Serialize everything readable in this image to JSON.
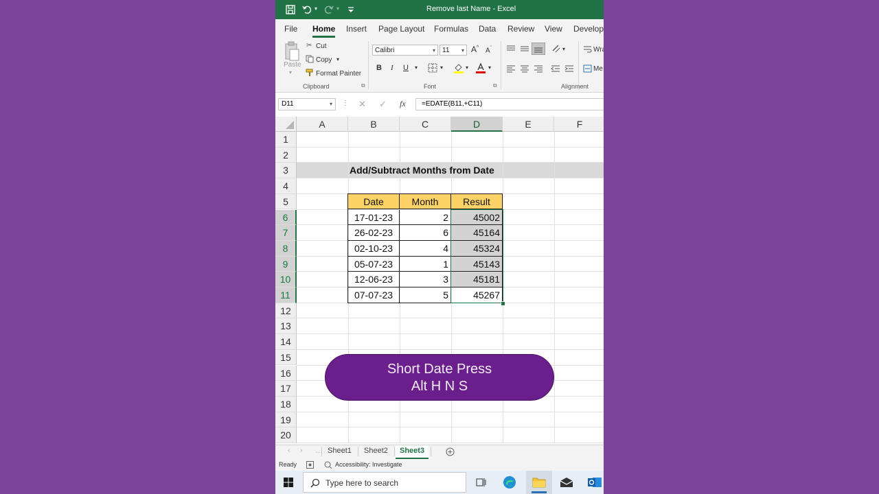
{
  "window": {
    "title": "Remove last Name  -  Excel"
  },
  "ribbon": {
    "tabs": [
      "File",
      "Home",
      "Insert",
      "Page Layout",
      "Formulas",
      "Data",
      "Review",
      "View",
      "Develope"
    ],
    "active_tab": "Home",
    "clipboard": {
      "paste": "Paste",
      "cut": "Cut",
      "copy": "Copy",
      "format_painter": "Format Painter",
      "label": "Clipboard"
    },
    "font": {
      "family": "Calibri",
      "size": "11",
      "bold": "B",
      "italic": "I",
      "underline": "U",
      "grow": "A",
      "shrink": "A",
      "label": "Font"
    },
    "alignment": {
      "wrap": "Wra",
      "merge": "Me",
      "label": "Alignment"
    }
  },
  "formula_bar": {
    "name_box": "D11",
    "fx": "fx",
    "formula": "=EDATE(B11,+C11)"
  },
  "grid": {
    "columns": [
      "A",
      "B",
      "C",
      "D",
      "E",
      "F"
    ],
    "selected_column": "D",
    "rows": [
      "1",
      "2",
      "3",
      "4",
      "5",
      "6",
      "7",
      "8",
      "9",
      "10",
      "11",
      "12",
      "13",
      "14",
      "15",
      "16",
      "17",
      "18",
      "19",
      "20"
    ],
    "sheet_title": "Add/Subtract Months from Date",
    "table": {
      "headers": [
        "Date",
        "Month",
        "Result"
      ],
      "rows": [
        [
          "17-01-23",
          "2",
          "45002"
        ],
        [
          "26-02-23",
          "6",
          "45164"
        ],
        [
          "02-10-23",
          "4",
          "45324"
        ],
        [
          "05-07-23",
          "1",
          "45143"
        ],
        [
          "12-06-23",
          "3",
          "45181"
        ],
        [
          "07-07-23",
          "5",
          "45267"
        ]
      ]
    }
  },
  "callout": {
    "line1": "Short Date Press",
    "line2": "Alt H N S"
  },
  "sheets": {
    "tabs": [
      "Sheet1",
      "Sheet2",
      "Sheet3"
    ],
    "active": "Sheet3"
  },
  "status": {
    "mode": "Ready",
    "accessibility": "Accessibility: Investigate"
  },
  "taskbar": {
    "search_placeholder": "Type here to search"
  },
  "colors": {
    "excel_green": "#217346",
    "header_fill": "#fdd266",
    "selection_fill": "#d3d3d3",
    "callout_fill": "#6a1f8c",
    "background": "#7b4597"
  }
}
